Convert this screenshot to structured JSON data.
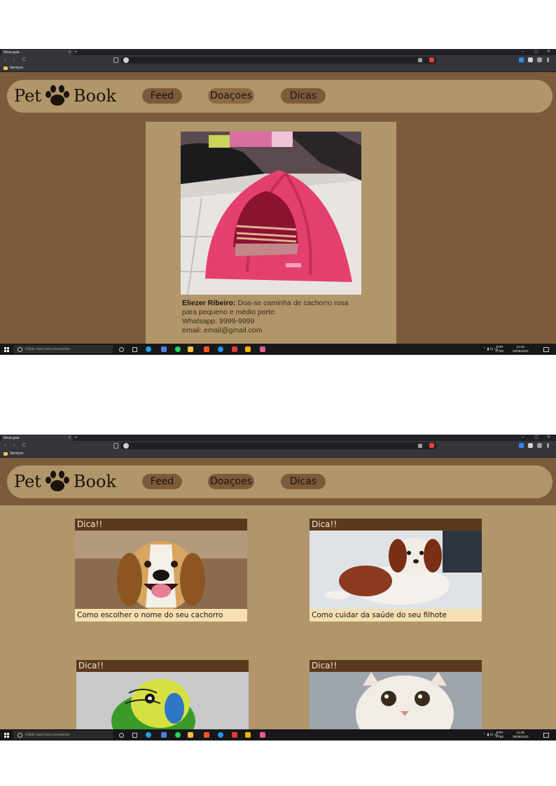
{
  "browser": {
    "tab_title": "Nova guia",
    "tab_close": "×",
    "new_tab": "+",
    "window_controls": [
      "–",
      "▢",
      "✕"
    ],
    "nav": [
      "‹",
      "›",
      "C"
    ],
    "bookmark_label": "Serviços"
  },
  "site": {
    "logo_left": "Pet",
    "logo_right": "Book",
    "nav": [
      {
        "label": "Feed"
      },
      {
        "label": "Doaçoes"
      },
      {
        "label": "Dicas"
      }
    ]
  },
  "donation_post": {
    "author": "Eliezer Ribeiro:",
    "text": "Doa-se caminha de cachorro rosa para pequeno e médio porte.",
    "whatsapp": "Whatsapp: 9999-9999",
    "email": "email: email@gmail.com"
  },
  "tips": [
    {
      "header": "Dica!!",
      "caption": "Como escolher o nome do seu cachorro"
    },
    {
      "header": "Dica!!",
      "caption": "Como cuidar da saúde do seu filhote"
    },
    {
      "header": "Dica!!",
      "caption": ""
    },
    {
      "header": "Dica!!",
      "caption": ""
    }
  ],
  "taskbar": {
    "search_placeholder": "Digite aqui para pesquisar",
    "lang": "POR",
    "lang_sub": "PTB2",
    "time": "21:06",
    "date": "28/08/2020"
  },
  "colors": {
    "page_bg": "#7b5b3c",
    "header_bg": "#b0966a",
    "tip_header": "#5a3a1c",
    "tip_caption_bg": "#f6dfb3"
  }
}
